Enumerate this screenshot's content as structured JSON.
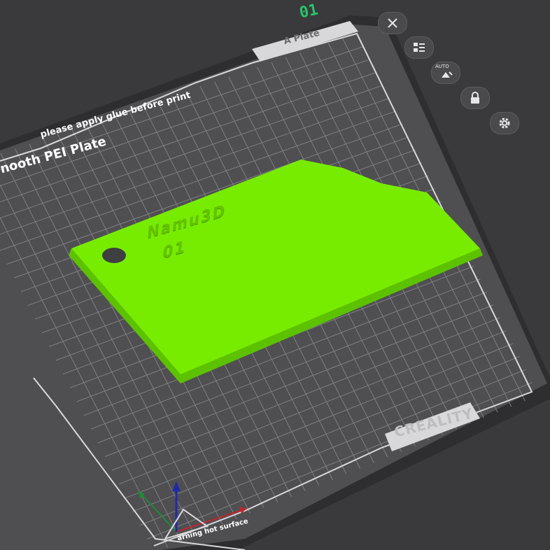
{
  "plate": {
    "id": "01",
    "name": "A Plate",
    "surface_label": "nooth PEI Plate",
    "glue_hint": "please apply glue before print",
    "brand": "CREALITY",
    "warning": "arning hot surface"
  },
  "model": {
    "line1": "Namu3D",
    "line2": "01",
    "color": "#78ec00"
  },
  "toolbar": {
    "buttons": [
      {
        "name": "close",
        "icon": "close-icon"
      },
      {
        "name": "arrange",
        "icon": "arrange-icon"
      },
      {
        "name": "auto-orient",
        "icon": "auto-orient-icon",
        "label": "AUTO"
      },
      {
        "name": "lock",
        "icon": "lock-icon"
      },
      {
        "name": "settings",
        "icon": "gear-icon"
      }
    ]
  },
  "colors": {
    "background": "#3a3a3c",
    "bed": "#505053",
    "grid": "#8a8a8e",
    "accent": "#27c46b"
  }
}
